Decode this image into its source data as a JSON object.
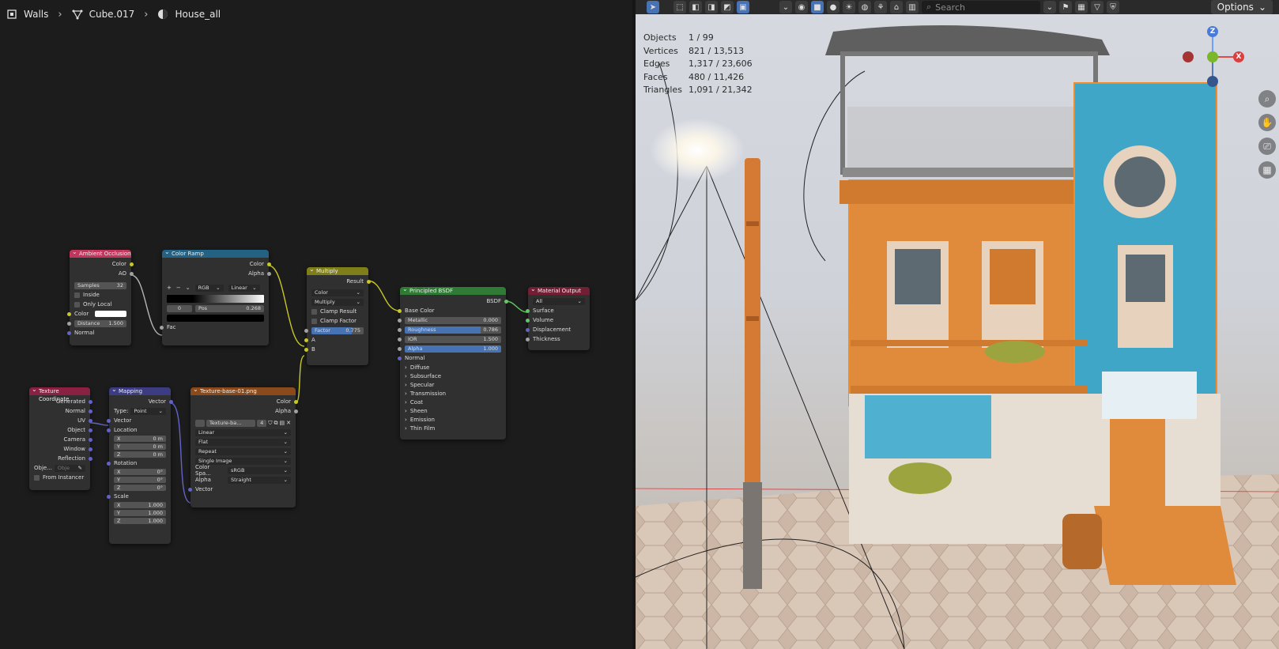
{
  "breadcrumb": {
    "object": "Walls",
    "mesh": "Cube.017",
    "material": "House_all"
  },
  "nodes": {
    "ao": {
      "title": "Ambient Occlusion",
      "out_color": "Color",
      "out_ao": "AO",
      "samples_label": "Samples",
      "samples_value": "32",
      "inside": "Inside",
      "only_local": "Only Local",
      "in_color": "Color",
      "distance_label": "Distance",
      "distance_value": "1.500",
      "normal": "Normal"
    },
    "color_ramp": {
      "title": "Color Ramp",
      "out_color": "Color",
      "out_alpha": "Alpha",
      "mode": "RGB",
      "interp": "Linear",
      "index": "0",
      "pos_label": "Pos",
      "pos_value": "0.268",
      "in_fac": "Fac"
    },
    "multiply": {
      "title": "Multiply",
      "out_result": "Result",
      "type": "Color",
      "blend": "Multiply",
      "clamp_result": "Clamp Result",
      "clamp_factor": "Clamp Factor",
      "factor_label": "Factor",
      "factor_value": "0.775",
      "in_a": "A",
      "in_b": "B"
    },
    "bsdf": {
      "title": "Principled BSDF",
      "out_bsdf": "BSDF",
      "base_color": "Base Color",
      "metallic_label": "Metallic",
      "metallic_value": "0.000",
      "roughness_label": "Roughness",
      "roughness_value": "0.786",
      "ior_label": "IOR",
      "ior_value": "1.500",
      "alpha_label": "Alpha",
      "alpha_value": "1.000",
      "normal": "Normal",
      "panels": [
        "Diffuse",
        "Subsurface",
        "Specular",
        "Transmission",
        "Coat",
        "Sheen",
        "Emission",
        "Thin Film"
      ]
    },
    "output": {
      "title": "Material Output",
      "target": "All",
      "surface": "Surface",
      "volume": "Volume",
      "displacement": "Displacement",
      "thickness": "Thickness"
    },
    "texcoord": {
      "title": "Texture Coordinate",
      "outputs": [
        "Generated",
        "Normal",
        "UV",
        "Object",
        "Camera",
        "Window",
        "Reflection"
      ],
      "object_label": "Obje...",
      "object_placeholder": "Obje",
      "from_instancer": "From Instancer"
    },
    "mapping": {
      "title": "Mapping",
      "out_vector": "Vector",
      "type_label": "Type:",
      "type_value": "Point",
      "in_vector": "Vector",
      "location": "Location",
      "loc": [
        {
          "axis": "X",
          "value": "0 m"
        },
        {
          "axis": "Y",
          "value": "0 m"
        },
        {
          "axis": "Z",
          "value": "0 m"
        }
      ],
      "rotation": "Rotation",
      "rot": [
        {
          "axis": "X",
          "value": "0°"
        },
        {
          "axis": "Y",
          "value": "0°"
        },
        {
          "axis": "Z",
          "value": "0°"
        }
      ],
      "scale": "Scale",
      "scl": [
        {
          "axis": "X",
          "value": "1.000"
        },
        {
          "axis": "Y",
          "value": "1.000"
        },
        {
          "axis": "Z",
          "value": "1.000"
        }
      ]
    },
    "image": {
      "title": "Texture-base-01.png",
      "out_color": "Color",
      "out_alpha": "Alpha",
      "image_name": "Texture-ba...",
      "users": "4",
      "interpolation": "Linear",
      "projection": "Flat",
      "extension": "Repeat",
      "source": "Single Image",
      "colorspace_label": "Color Spa...",
      "colorspace_value": "sRGB",
      "alpha_label": "Alpha",
      "alpha_value": "Straight",
      "in_vector": "Vector"
    }
  },
  "viewport": {
    "search_placeholder": "Search",
    "options": "Options",
    "stats": [
      {
        "label": "Objects",
        "value": "1 / 99"
      },
      {
        "label": "Vertices",
        "value": "821 / 13,513"
      },
      {
        "label": "Edges",
        "value": "1,317 / 23,606"
      },
      {
        "label": "Faces",
        "value": "480 / 11,426"
      },
      {
        "label": "Triangles",
        "value": "1,091 / 21,342"
      }
    ],
    "gizmo": {
      "z": "Z",
      "x": "X"
    }
  },
  "colors": {
    "accent": "#4772b3",
    "selection_outline": "#f08c2a",
    "house_orange": "#e08a3c",
    "house_blue": "#3fa6c8"
  }
}
